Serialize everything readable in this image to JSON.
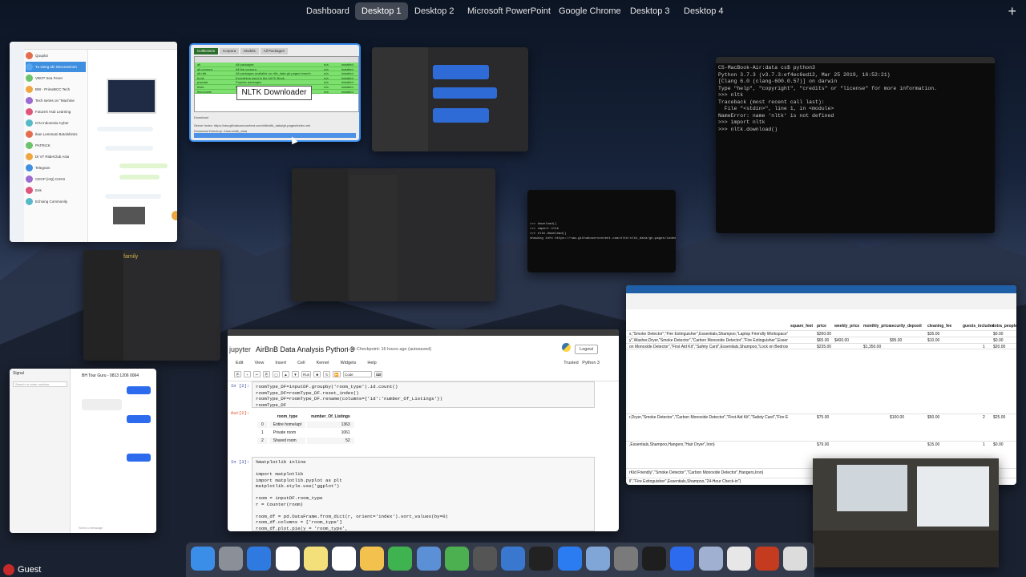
{
  "spaces_bar": {
    "spaces": [
      "Dashboard",
      "Desktop 1",
      "Desktop 2",
      "Microsoft PowerPoint",
      "Google Chrome",
      "Desktop 3",
      "Desktop 4"
    ],
    "active": "Desktop 1",
    "add_label": "+"
  },
  "nltk": {
    "title": "NLTK Downloader",
    "tabs": [
      "Collections",
      "Corpora",
      "Models",
      "All Packages"
    ],
    "columns": [
      "Identifier",
      "Name",
      "Size",
      "Status"
    ],
    "rows": [
      [
        "all",
        "All packages",
        "n/a",
        "installed"
      ],
      [
        "all-corpora",
        "All the corpora",
        "n/a",
        "installed"
      ],
      [
        "all-nltk",
        "All packages available on nltk_data gh-pages branch",
        "n/a",
        "installed"
      ],
      [
        "book",
        "Everything used in the NLTK Book",
        "n/a",
        "installed"
      ],
      [
        "popular",
        "Popular packages",
        "n/a",
        "installed"
      ],
      [
        "tests",
        "Packages for running tests",
        "n/a",
        "installed"
      ],
      [
        "third-party",
        "Third-party data packages",
        "n/a",
        "installed"
      ]
    ],
    "server_index_label": "Server Index:",
    "server_index": "https://raw.githubusercontent.com/nltk/nltk_data/gh-pages/index.xml",
    "download_dir_label": "Download Directory:",
    "download_dir": "/Users/nltk_data",
    "status": "Finished downloading collection 'all'.",
    "download_button": "Download",
    "progress": 1.0
  },
  "python_terminal": {
    "lines": [
      "CS-MacBook-Air:data cs$ python3",
      "Python 3.7.3 (v3.7.3:ef4ec6ed12, Mar 25 2019, 16:52:21)",
      "[Clang 6.0 (clang-600.0.57)] on darwin",
      "Type \"help\", \"copyright\", \"credits\" or \"license\" for more information.",
      ">>> nltk",
      "Traceback (most recent call last):",
      "  File \"<stdin>\", line 1, in <module>",
      "NameError: name 'nltk' is not defined",
      ">>> import nltk",
      ">>> nltk.download()"
    ]
  },
  "small_terminal": {
    "lines": [
      ">>> download()",
      ">>> import nltk",
      ">>> nltk.download()",
      "showing info https://raw.githubusercontent.com/nltk/nltk_data/gh-pages/index.xml"
    ]
  },
  "spreadsheet": {
    "columns": [
      "square_feet",
      "price",
      "weekly_price",
      "monthly_price",
      "security_deposit",
      "cleaning_fee",
      "guests_included",
      "extra_people"
    ],
    "rows": [
      [
        "s,\"Smoke Detector\",\"Fire Extinguisher\",Essentials,Shampoo,\"Laptop Friendly Workspace\"}",
        "",
        "$260.00",
        "",
        "",
        "",
        "$35.00",
        "",
        "$0.00"
      ],
      [
        "y\",Washer,Dryer,\"Smoke Detector\",\"Carbon Monoxide Detector\",\"Fire Extinguisher\",Essentials,S",
        "",
        "$65.00",
        "$400.00",
        "",
        "$95.00",
        "$10.00",
        "",
        "$0.00"
      ],
      [
        "on Monoxide Detector\",\"First Aid Kit\",\"Safety Card\",Essentials,Shampoo,\"Lock on Bedroom Door\",\"H",
        "",
        "$235.00",
        "",
        "$1,350.00",
        "",
        "",
        "1",
        "$20.00"
      ],
      [
        "r,Dryer,\"Smoke Detector\",\"Carbon Monoxide Detector\",\"First Aid Kit\",\"Safety Card\",\"Fire Extinguisher",
        "",
        "$75.00",
        "",
        "",
        "$100.00",
        "$50.00",
        "2",
        "$25.00"
      ],
      [
        ",Essentials,Shampoo,Hangers,\"Hair Dryer\",Iron}",
        "",
        "$79.00",
        "",
        "",
        "",
        "$15.00",
        "1",
        "$0.00"
      ],
      [
        "rKid Friendly\",\"Smoke Detector\",\"Carbon Monoxide Detector\",Hangers,Iron}",
        "",
        "",
        "",
        "",
        "",
        "",
        "",
        ""
      ],
      [
        "ll\",\"Fire Extinguisher\",Essentials,Shampoo,\"24-Hour Check-in\"}",
        "",
        "",
        "",
        "",
        "",
        "",
        "",
        ""
      ]
    ]
  },
  "jupyter": {
    "logo": "jupyter",
    "title": "AirBnB Data Analysis Python 3",
    "checkpoint": "Last Checkpoint: 16 hours ago  (autosaved)",
    "logout": "Logout",
    "menu": [
      "Edit",
      "View",
      "Insert",
      "Cell",
      "Kernel",
      "Widgets",
      "Help"
    ],
    "trusted": "Trusted",
    "kernel": "Python 3",
    "toolbar_run": "Run",
    "toolbar_celltype": "Code",
    "cell2_prompt": "In [2]:",
    "cell2_code": "roomType_DF=inputDF.groupby('room_type').id.count()\nroomType_DF=roomType_DF.reset_index()\nroomType_DF=roomType_DF.rename(columns={'id':'number_Of_Listings'})\nroomType_DF",
    "out2_prompt": "Out[2]:",
    "out2_columns": [
      "",
      "room_type",
      "number_Of_Listings"
    ],
    "out2_rows": [
      [
        "0",
        "Entire home/apt",
        "1363"
      ],
      [
        "1",
        "Private room",
        "1061"
      ],
      [
        "2",
        "Shared room",
        "52"
      ]
    ],
    "cell3_prompt": "In [3]:",
    "cell3_code": "%matplotlib inline\n\nimport matplotlib\nimport matplotlib.pyplot as plt\nmatplotlib.style.use('ggplot')\n\nroom = inputDF.room_type\nr = Counter(room)\n\nroom_df = pd.DataFrame.from_dict(r, orient='index').sort_values(by=0)\nroom_df.columns = ['room_type']\nroom_df.plot.pie(y = 'room_type',"
  },
  "signal": {
    "header": "Signal",
    "chat_title": "BH Tour Guru - 0813 1206 0064",
    "search_placeholder": "Search or enter number",
    "composer_placeholder": "Send a message"
  },
  "family_notes": {
    "title": "family"
  },
  "dock": {
    "apps": [
      "Finder",
      "Launchpad",
      "Safari",
      "Calendar",
      "Notes",
      "Reminders",
      "Photos",
      "Messages",
      "Keynote",
      "Numbers",
      "Mission Control",
      "Xcode",
      "Audio",
      "App Store",
      "Unknown",
      "System Preferences",
      "Terminal",
      "Signal",
      "Rocket",
      "Google Chrome",
      "PowerPoint",
      "Documents"
    ]
  },
  "user": {
    "name": "Guest"
  }
}
